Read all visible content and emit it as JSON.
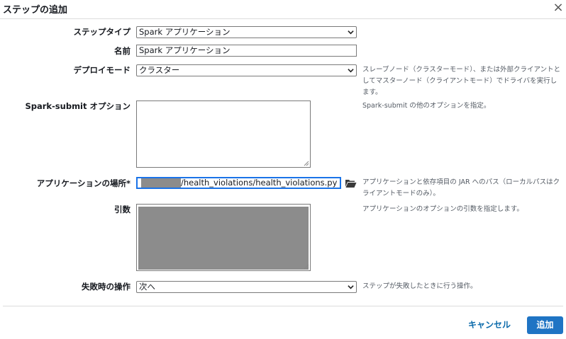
{
  "dialog": {
    "title": "ステップの追加",
    "close_symbol": "×"
  },
  "fields": {
    "step_type": {
      "label": "ステップタイプ",
      "value": "Spark アプリケーション"
    },
    "name": {
      "label": "名前",
      "value": "Spark アプリケーション"
    },
    "deploy_mode": {
      "label": "デプロイモード",
      "value": "クラスター",
      "help": "スレーブノード（クラスターモード）、または外部クライアントとしてマスターノード（クライアントモード）でドライバを実行します。"
    },
    "spark_submit_options": {
      "label": "Spark-submit オプション",
      "value": "",
      "help": "Spark-submit の他のオプションを指定。"
    },
    "app_location": {
      "label": "アプリケーションの場所*",
      "value": "/health_violations/health_violations.py",
      "help": "アプリケーションと依存項目の JAR へのパス（ローカルパスはクライアントモードのみ）。",
      "browse_icon": "folder-open-icon"
    },
    "arguments": {
      "label": "引数",
      "help": "アプリケーションのオプションの引数を指定します。"
    },
    "action_on_failure": {
      "label": "失敗時の操作",
      "value": "次へ",
      "help": "ステップが失敗したときに行う操作。"
    }
  },
  "footer": {
    "cancel_label": "キャンセル",
    "add_label": "追加"
  },
  "colors": {
    "primary_button": "#1f74c4",
    "link": "#0a6aab",
    "focus_border": "#1a73e8",
    "redaction": "#8c8c8c"
  }
}
